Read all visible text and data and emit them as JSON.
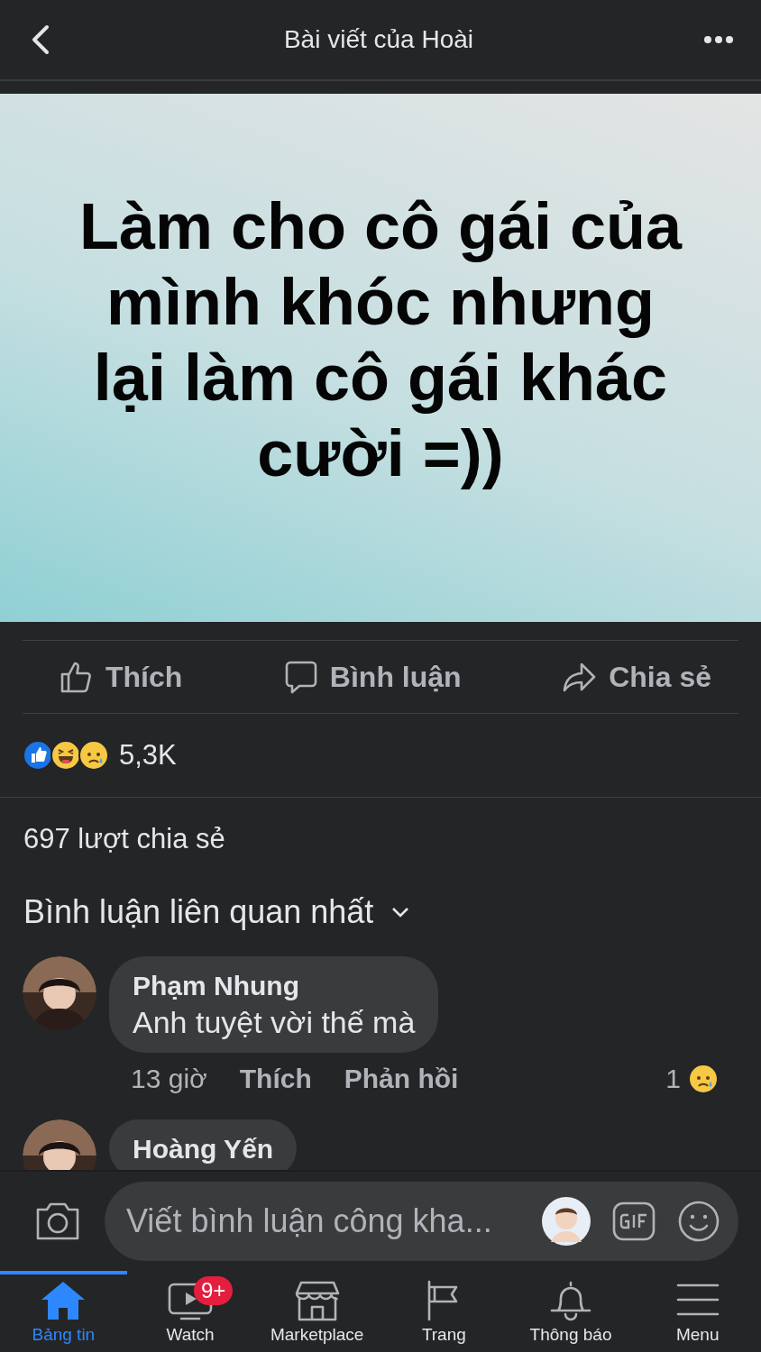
{
  "header": {
    "title": "Bài viết của Hoài"
  },
  "post": {
    "text": "Làm cho cô gái của mình khóc nhưng lại làm cô gái khác cười =))"
  },
  "actions": [
    {
      "kind": "like",
      "label": "Thích"
    },
    {
      "kind": "comment",
      "label": "Bình luận"
    },
    {
      "kind": "share",
      "label": "Chia sẻ"
    }
  ],
  "reactions": {
    "icons": [
      {
        "kind": "like"
      },
      {
        "kind": "haha"
      },
      {
        "kind": "sad"
      }
    ],
    "count": "5,3K"
  },
  "shares": "697 lượt chia sẻ",
  "comments_filter": {
    "label": "Bình luận liên quan nhất"
  },
  "comments": [
    {
      "author": "Phạm Nhung",
      "text": "Anh tuyệt vời thế mà",
      "time": "13 giờ",
      "like": "Thích",
      "reply": "Phản hồi",
      "reaction": {
        "kind": "sad",
        "count": "1"
      }
    },
    {
      "author": "Hoàng Yến"
    }
  ],
  "composer": {
    "placeholder": "Viết bình luận công kha..."
  },
  "tabs": [
    {
      "kind": "home",
      "label": "Bảng tin",
      "selected": true
    },
    {
      "kind": "watch",
      "label": "Watch",
      "badge": "9+",
      "selected": false
    },
    {
      "kind": "marketplace",
      "label": "Marketplace",
      "selected": false
    },
    {
      "kind": "pages",
      "label": "Trang",
      "selected": false
    },
    {
      "kind": "notifications",
      "label": "Thông báo",
      "selected": false
    },
    {
      "kind": "menu",
      "label": "Menu",
      "selected": false
    }
  ]
}
